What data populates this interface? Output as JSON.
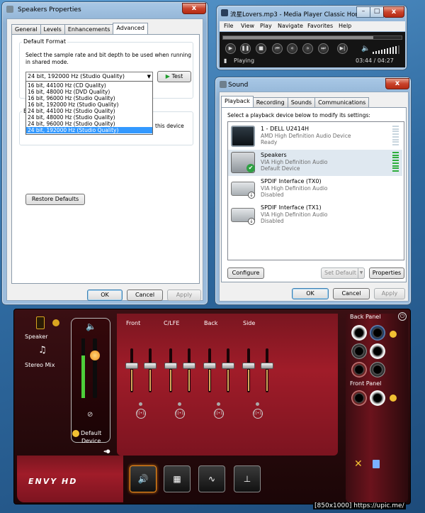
{
  "speakers_window": {
    "title": "Speakers Properties",
    "close_label": "x",
    "tabs": [
      {
        "label": "General"
      },
      {
        "label": "Levels"
      },
      {
        "label": "Enhancements"
      },
      {
        "label": "Advanced"
      }
    ],
    "default_format": {
      "group_label": "Default Format",
      "description_line1": "Select the sample rate and bit depth to be used when running",
      "description_line2": "in shared mode.",
      "selected": "24 bit, 192000 Hz (Studio Quality)",
      "test_label": "Test",
      "options": [
        {
          "label": "16 bit, 44100 Hz (CD Quality)"
        },
        {
          "label": "16 bit, 48000 Hz (DVD Quality)"
        },
        {
          "label": "16 bit, 96000 Hz (Studio Quality)"
        },
        {
          "label": "16 bit, 192000 Hz (Studio Quality)"
        },
        {
          "label": "24 bit, 44100 Hz (Studio Quality)"
        },
        {
          "label": "24 bit, 48000 Hz (Studio Quality)"
        },
        {
          "label": "24 bit, 96000 Hz (Studio Quality)"
        },
        {
          "label": "24 bit, 192000 Hz (Studio Quality)"
        }
      ]
    },
    "exclusive": {
      "group_label_partial": "E",
      "text_partial": "this device"
    },
    "restore_defaults": "Restore Defaults",
    "ok": "OK",
    "cancel": "Cancel",
    "apply": "Apply"
  },
  "mpc_window": {
    "title": "流星Lovers.mp3 - Media Player Classic Hom...",
    "minimize": "–",
    "maximize": "□",
    "close": "x",
    "menu": [
      {
        "label": "File"
      },
      {
        "label": "View"
      },
      {
        "label": "Play"
      },
      {
        "label": "Navigate"
      },
      {
        "label": "Favorites"
      },
      {
        "label": "Help"
      }
    ],
    "controls": [
      {
        "icon": "play-icon",
        "glyph": "▶"
      },
      {
        "icon": "pause-icon",
        "glyph": "❚❚"
      },
      {
        "icon": "stop-icon",
        "glyph": "■"
      },
      {
        "icon": "skip-back-icon",
        "glyph": "⏮"
      },
      {
        "icon": "rewind-icon",
        "glyph": "«"
      },
      {
        "icon": "fast-forward-icon",
        "glyph": "»"
      },
      {
        "icon": "skip-forward-icon",
        "glyph": "⏭"
      },
      {
        "icon": "frame-step-icon",
        "glyph": "▶|"
      }
    ],
    "status": "Playing",
    "time": "03:44 / 04:27",
    "seek_position": 0.84,
    "volume_level": 0.9
  },
  "sound_window": {
    "title": "Sound",
    "close_label": "x",
    "tabs": [
      {
        "label": "Playback"
      },
      {
        "label": "Recording"
      },
      {
        "label": "Sounds"
      },
      {
        "label": "Communications"
      }
    ],
    "instruction": "Select a playback device below to modify its settings:",
    "devices": [
      {
        "name": "1 - DELL U2414H",
        "sub1": "AMD High Definition Audio Device",
        "sub2": "Ready",
        "icon": "monitor-icon",
        "meter_on": false
      },
      {
        "name": "Speakers",
        "sub1": "VIA High Definition Audio",
        "sub2": "Default Device",
        "icon": "speaker-icon",
        "meter_on": true
      },
      {
        "name": "SPDIF Interface (TX0)",
        "sub1": "VIA High Definition Audio",
        "sub2": "Disabled",
        "icon": "spdif-icon",
        "meter_on": false
      },
      {
        "name": "SPDIF Interface (TX1)",
        "sub1": "VIA High Definition Audio",
        "sub2": "Disabled",
        "icon": "spdif-icon",
        "meter_on": false
      }
    ],
    "configure": "Configure",
    "set_default": "Set Default",
    "properties": "Properties",
    "ok": "OK",
    "cancel": "Cancel",
    "apply": "Apply"
  },
  "envy": {
    "nav": [
      {
        "label": "Speaker",
        "icon": "speaker-icon"
      },
      {
        "label": "Stereo Mix",
        "icon": "music-note-icon"
      }
    ],
    "default_device_label": "Default\nDevice",
    "channels": [
      {
        "label": "Front"
      },
      {
        "label": "C/LFE"
      },
      {
        "label": "Back"
      },
      {
        "label": "Side"
      }
    ],
    "master_level": 0.72,
    "logo": "ENVY HD",
    "back_panel": "Back Panel",
    "front_panel": "Front Panel",
    "bottom_buttons": [
      {
        "icon": "speaker-config-icon"
      },
      {
        "icon": "equalizer-icon"
      },
      {
        "icon": "waveform-icon"
      },
      {
        "icon": "environment-icon"
      }
    ]
  },
  "watermark": "[850x1000] https://upic.me/"
}
